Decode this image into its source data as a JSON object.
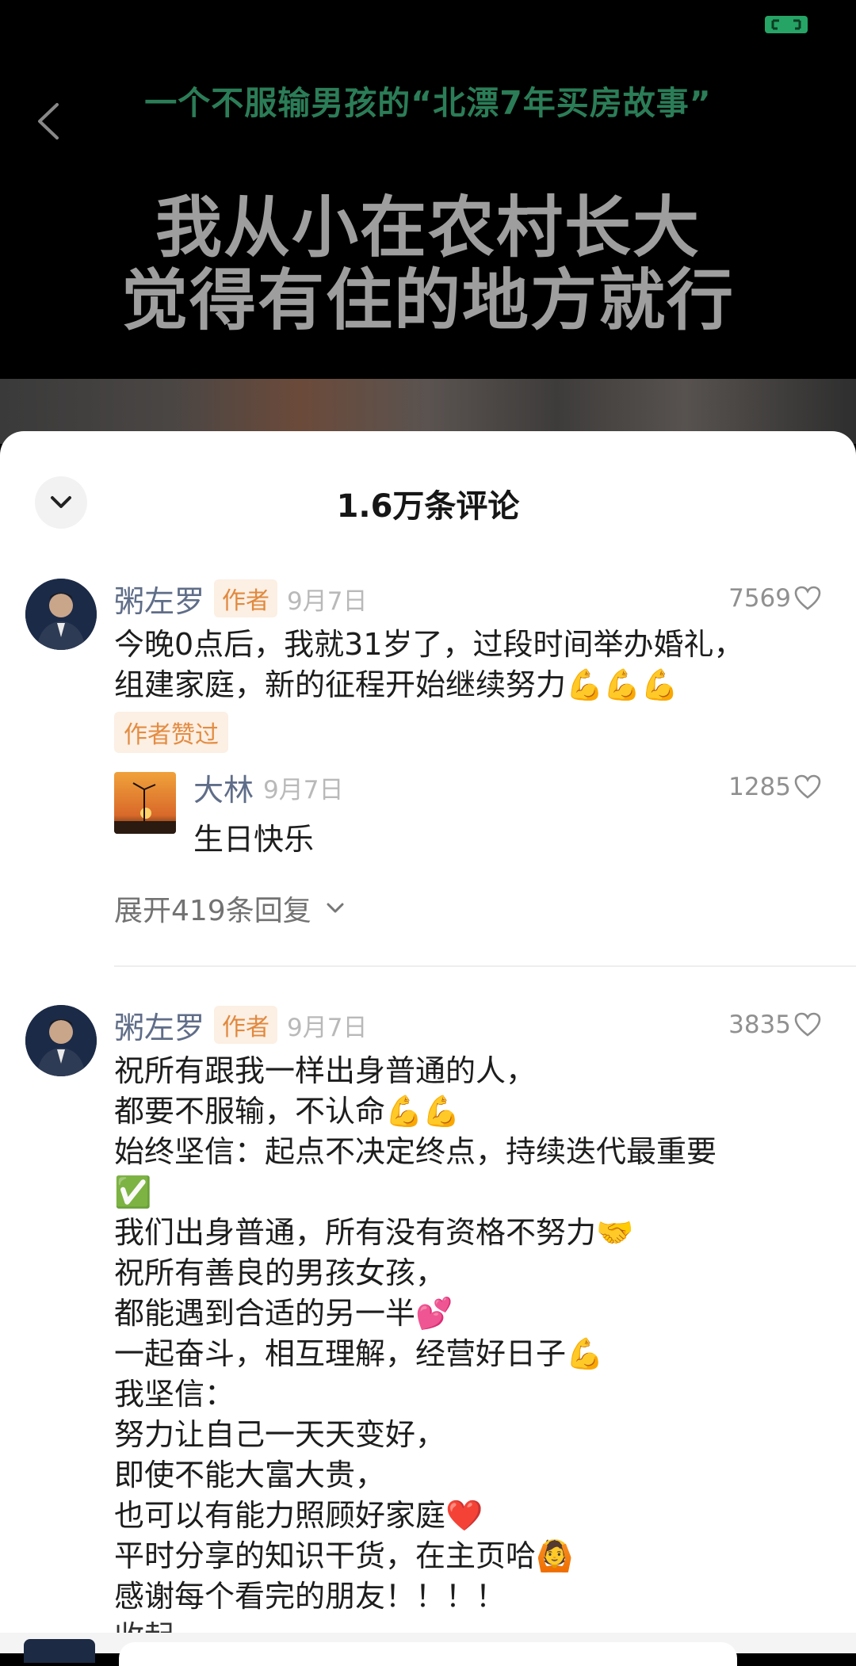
{
  "video": {
    "overlay_small": "一个不服输男孩的“北漂7年买房故事”",
    "overlay_line1": "我从小在农村长大",
    "overlay_line2": "觉得有住的地方就行"
  },
  "sheet": {
    "title": "1.6万条评论"
  },
  "comments": [
    {
      "user": "粥左罗",
      "author_tag": "作者",
      "date": "9月7日",
      "likes": "7569",
      "text": "今晚0点后，我就31岁了，过段时间举办婚礼，\n组建家庭，新的征程开始继续努力💪💪💪",
      "liked_tag": "作者赞过",
      "reply": {
        "user": "大林",
        "date": "9月7日",
        "likes": "1285",
        "text": "生日快乐"
      },
      "expand_label": "展开419条回复"
    },
    {
      "user": "粥左罗",
      "author_tag": "作者",
      "date": "9月7日",
      "likes": "3835",
      "text": "祝所有跟我一样出身普通的人，\n都要不服输，不认命💪💪\n始终坚信：起点不决定终点，持续迭代最重要\n✅\n我们出身普通，所有没有资格不努力🤝\n祝所有善良的男孩女孩，\n都能遇到合适的另一半💕\n一起奋斗，相互理解，经营好日子💪\n我坚信：\n努力让自己一天天变好，\n即使不能大富大贵，\n也可以有能力照顾好家庭❤️\n平时分享的知识干货，在主页哈🙆\n感谢每个看完的朋友！！！！",
      "collapse_label": "收起"
    }
  ],
  "colors": {
    "accent_green": "#2b7d57",
    "author_tag_bg": "#fcefe3",
    "author_tag_text": "#e0893f",
    "username": "#5f6d88"
  }
}
